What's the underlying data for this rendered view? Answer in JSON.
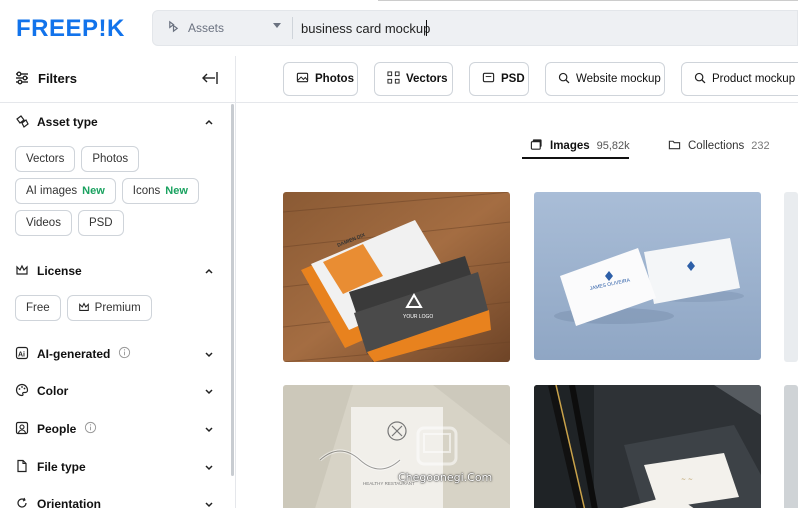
{
  "header": {
    "logo": "FREEP!K",
    "asset_select": "Assets",
    "search_value": "business card mockup"
  },
  "sidebar": {
    "title": "Filters",
    "sections": [
      {
        "title": "Asset type",
        "expanded": true,
        "chips": [
          "Vectors",
          "Photos",
          "AI images",
          "Icons",
          "Videos",
          "PSD"
        ],
        "new_badge": "New"
      },
      {
        "title": "License",
        "expanded": true,
        "chips": [
          "Free",
          "Premium"
        ]
      },
      {
        "title": "AI-generated",
        "expanded": false
      },
      {
        "title": "Color",
        "expanded": false
      },
      {
        "title": "People",
        "expanded": false
      },
      {
        "title": "File type",
        "expanded": false
      },
      {
        "title": "Orientation",
        "expanded": false
      }
    ]
  },
  "toolbar": {
    "buttons": [
      "Photos",
      "Vectors",
      "PSD",
      "Website mockup",
      "Product mockup"
    ]
  },
  "tabs": [
    {
      "label": "Images",
      "count": "95,82k",
      "active": true
    },
    {
      "label": "Collections",
      "count": "232",
      "active": false
    }
  ],
  "cards": [
    {
      "name": "DAMIEN DIX",
      "logo": "YOUR LOGO"
    },
    {
      "name": "JAMES OLIVEIRA"
    },
    {
      "name": "HEALTHY RESTAURANT"
    },
    {
      "name": "dark-desk-card"
    }
  ],
  "watermark": "Chegoonegi.Com",
  "colors": {
    "brand": "#1273eb",
    "new": "#1aa260",
    "orange": "#e8821e"
  }
}
